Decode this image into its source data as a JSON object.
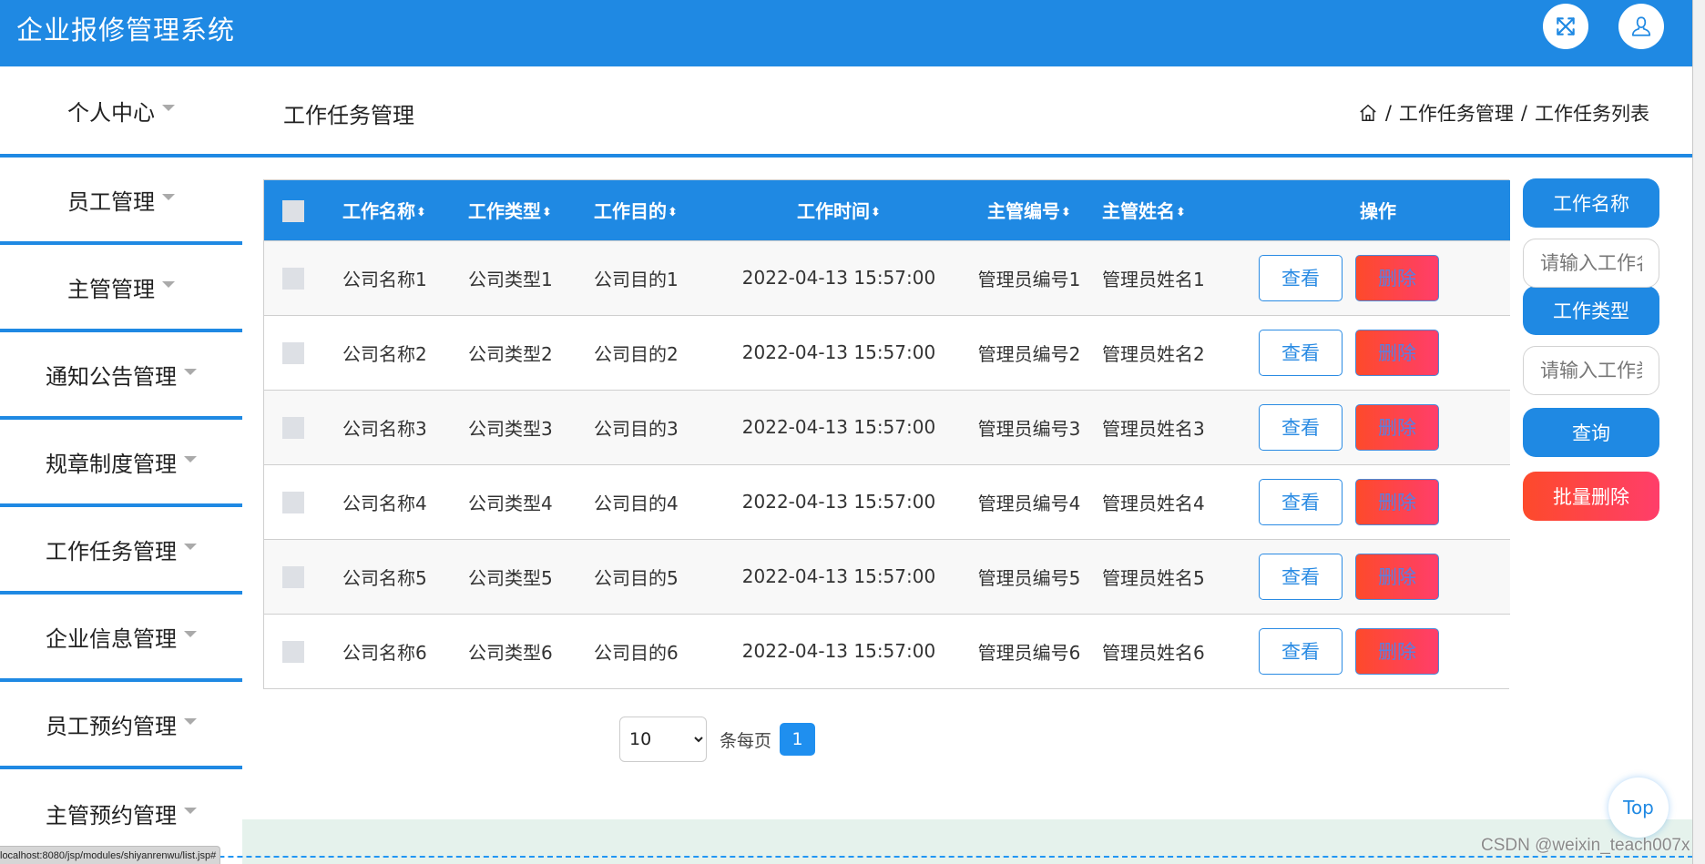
{
  "header": {
    "app_title": "企业报修管理系统",
    "fullscreen_icon": "expand-arrows-icon",
    "user_icon": "user-icon"
  },
  "title_row": {
    "sidebar_first": "个人中心",
    "page_title": "工作任务管理",
    "breadcrumb": [
      "工作任务管理",
      "工作任务列表"
    ],
    "breadcrumb_sep": "/"
  },
  "sidebar": {
    "items": [
      {
        "label": "员工管理"
      },
      {
        "label": "主管管理"
      },
      {
        "label": "通知公告管理"
      },
      {
        "label": "规章制度管理"
      },
      {
        "label": "工作任务管理"
      },
      {
        "label": "企业信息管理"
      },
      {
        "label": "员工预约管理"
      },
      {
        "label": "主管预约管理"
      }
    ]
  },
  "table": {
    "sort_glyph": "⬍",
    "columns": [
      "工作名称",
      "工作类型",
      "工作目的",
      "工作时间",
      "主管编号",
      "主管姓名",
      "操作"
    ],
    "view_label": "查看",
    "delete_label": "删除",
    "rows": [
      [
        "公司名称1",
        "公司类型1",
        "公司目的1",
        "2022-04-13 15:57:00",
        "管理员编号1",
        "管理员姓名1"
      ],
      [
        "公司名称2",
        "公司类型2",
        "公司目的2",
        "2022-04-13 15:57:00",
        "管理员编号2",
        "管理员姓名2"
      ],
      [
        "公司名称3",
        "公司类型3",
        "公司目的3",
        "2022-04-13 15:57:00",
        "管理员编号3",
        "管理员姓名3"
      ],
      [
        "公司名称4",
        "公司类型4",
        "公司目的4",
        "2022-04-13 15:57:00",
        "管理员编号4",
        "管理员姓名4"
      ],
      [
        "公司名称5",
        "公司类型5",
        "公司目的5",
        "2022-04-13 15:57:00",
        "管理员编号5",
        "管理员姓名5"
      ],
      [
        "公司名称6",
        "公司类型6",
        "公司目的6",
        "2022-04-13 15:57:00",
        "管理员编号6",
        "管理员姓名6"
      ]
    ]
  },
  "search_panel": {
    "name_label": "工作名称",
    "name_placeholder": "请输入工作名称",
    "name_value": "",
    "type_label": "工作类型",
    "type_placeholder": "请输入工作类型",
    "type_value": "",
    "query_label": "查询",
    "batch_delete_label": "批量删除"
  },
  "pagination": {
    "page_size": "10",
    "per_page_label": "条每页",
    "current_page": "1"
  },
  "footer": {
    "status_url": "localhost:8080/jsp/modules/shiyanrenwu/list.jsp#",
    "top_label": "Top",
    "watermark": "CSDN @weixin_teach007x"
  },
  "colors": {
    "primary": "#1f89e3",
    "danger_start": "#fd4a2b",
    "danger_end": "#ff3e6a",
    "band": "#e5f2ec"
  }
}
